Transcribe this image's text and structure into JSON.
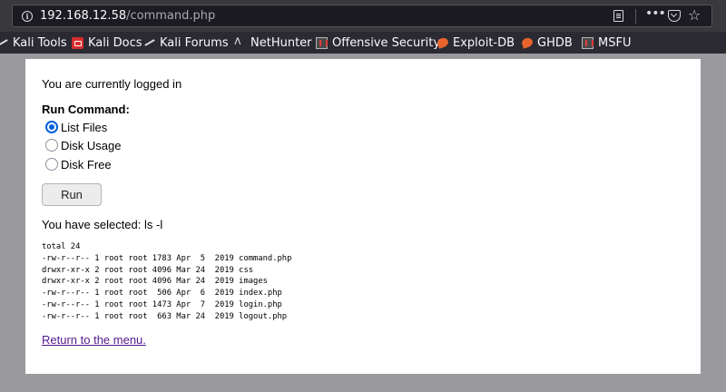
{
  "browser": {
    "url_host": "192.168.12.58",
    "url_path": "/command.php"
  },
  "bookmarks": [
    {
      "label": "Kali Tools",
      "icon": "kali-icon"
    },
    {
      "label": "Kali Docs",
      "icon": "kali-docs-icon"
    },
    {
      "label": "Kali Forums",
      "icon": "kali-icon"
    },
    {
      "label": "NetHunter",
      "icon": "nethunter-icon"
    },
    {
      "label": "Offensive Security",
      "icon": "offsec-icon"
    },
    {
      "label": "Exploit-DB",
      "icon": "exploit-db-icon"
    },
    {
      "label": "GHDB",
      "icon": "exploit-db-icon"
    },
    {
      "label": "MSFU",
      "icon": "offsec-icon"
    }
  ],
  "page": {
    "status": "You are currently logged in",
    "run_command_label": "Run Command:",
    "options": [
      {
        "label": "List Files",
        "checked": true
      },
      {
        "label": "Disk Usage",
        "checked": false
      },
      {
        "label": "Disk Free",
        "checked": false
      }
    ],
    "run_button": "Run",
    "selected_text": "You have selected: ls -l",
    "output_lines": [
      "total 24",
      "-rw-r--r-- 1 root root 1783 Apr  5  2019 command.php",
      "drwxr-xr-x 2 root root 4096 Mar 24  2019 css",
      "drwxr-xr-x 2 root root 4096 Mar 24  2019 images",
      "-rw-r--r-- 1 root root  506 Apr  6  2019 index.php",
      "-rw-r--r-- 1 root root 1473 Apr  7  2019 login.php",
      "-rw-r--r-- 1 root root  663 Mar 24  2019 logout.php"
    ],
    "return_link": "Return to the menu."
  }
}
